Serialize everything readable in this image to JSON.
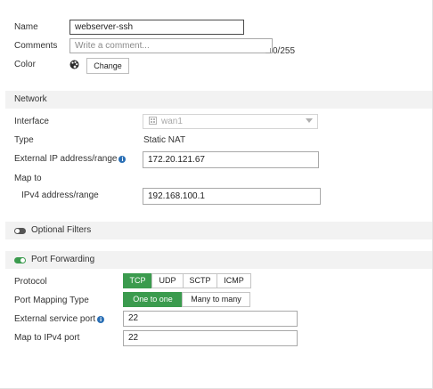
{
  "form": {
    "name_label": "Name",
    "name_value": "webserver-ssh",
    "comments_label": "Comments",
    "comments_placeholder": "Write a comment...",
    "comments_counter": "0/255",
    "color_label": "Color",
    "color_change_label": "Change"
  },
  "network": {
    "section_title": "Network",
    "interface_label": "Interface",
    "interface_value": "wan1",
    "type_label": "Type",
    "type_value": "Static NAT",
    "external_ip_label": "External IP address/range",
    "external_ip_value": "172.20.121.67",
    "map_to_label": "Map to",
    "ipv4_range_label": "IPv4 address/range",
    "ipv4_range_value": "192.168.100.1"
  },
  "optional_filters": {
    "title": "Optional Filters",
    "enabled": false
  },
  "port_forwarding": {
    "title": "Port Forwarding",
    "enabled": true,
    "protocol_label": "Protocol",
    "protocols": [
      "TCP",
      "UDP",
      "SCTP",
      "ICMP"
    ],
    "protocol_selected": "TCP",
    "mapping_type_label": "Port Mapping Type",
    "mapping_types": [
      "One to one",
      "Many to many"
    ],
    "mapping_selected": "One to one",
    "external_port_label": "External service port",
    "external_port_value": "22",
    "map_port_label": "Map to IPv4 port",
    "map_port_value": "22"
  },
  "colors": {
    "accent_green": "#3b9b4e",
    "info_blue": "#2a6fb5"
  }
}
